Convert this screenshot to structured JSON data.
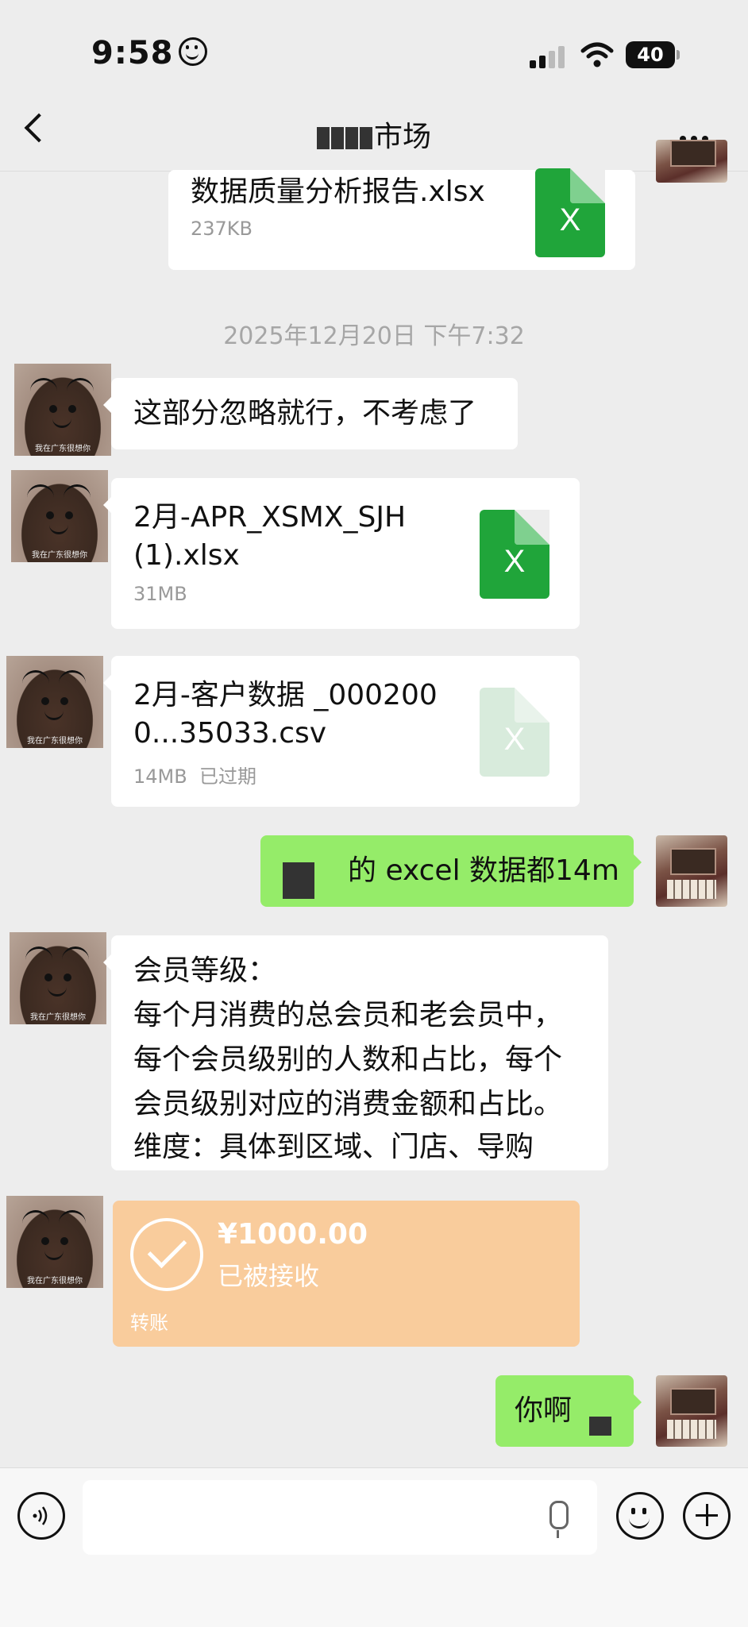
{
  "status_bar": {
    "time": "9:58",
    "battery": "40"
  },
  "nav": {
    "title": "市场"
  },
  "messages": {
    "file_top": {
      "name": "数据质量分析报告.xlsx",
      "size": "237KB",
      "icon_letter": "X"
    },
    "timestamp": "2025年12月20日 下午7:32",
    "text_ignore": "这部分忽略就行，不考虑了",
    "file_apr": {
      "name": "2月-APR_XSMX_SJH (1).xlsx",
      "size": "31MB",
      "icon_letter": "X"
    },
    "file_customer": {
      "name": "2月-客户数据 _0002000...35033.csv",
      "size": "14MB",
      "status": "已过期",
      "icon_letter": "X"
    },
    "sent_excel": "的 excel 数据都14m",
    "member_text": {
      "line1": "会员等级：",
      "line2": "每个月消费的总会员和老会员中，",
      "line3": "每个会员级别的人数和占比，每个",
      "line4": "会员级别对应的消费金额和占比。",
      "line5": "维度：具体到区域、门店、导购"
    },
    "transfer": {
      "amount": "¥1000.00",
      "status": "已被接收",
      "label": "转账"
    },
    "sent_last": "你啊"
  },
  "avatar_caption": "我在广东很想你",
  "colors": {
    "green_bubble": "#95ec69",
    "file_icon": "#20a53a",
    "transfer": "#f9cc9c"
  },
  "input": {
    "placeholder": ""
  }
}
